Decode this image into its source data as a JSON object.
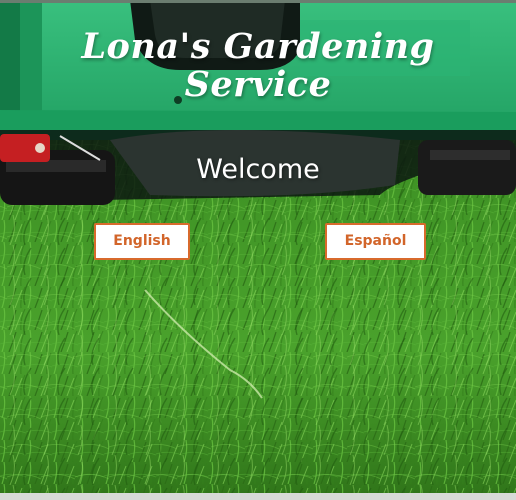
{
  "header": {
    "title_line1": "Lona's Gardening",
    "title_line2": "Service"
  },
  "main": {
    "welcome": "Welcome",
    "languages": [
      {
        "label": "English"
      },
      {
        "label": "Español"
      }
    ]
  },
  "colors": {
    "accent": "#d86a2c",
    "mower_green": "#2fb573",
    "grass": "#3a8a22"
  },
  "background": {
    "image": "lawn-mower-on-grass"
  }
}
